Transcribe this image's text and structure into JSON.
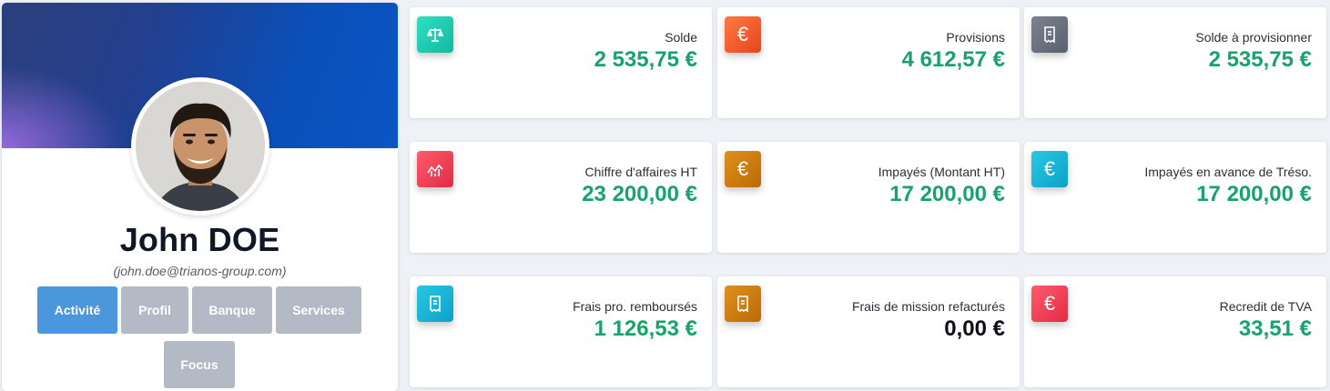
{
  "profile": {
    "name": "John DOE",
    "email": "(john.doe@trianos-group.com)",
    "tabs": [
      "Activité",
      "Profil",
      "Banque",
      "Services",
      "Focus"
    ]
  },
  "cards": [
    {
      "label": "Solde",
      "value": "2 535,75 €",
      "icon": "balance-scale-icon",
      "color": "#13b8a4"
    },
    {
      "label": "Provisions",
      "value": "4 612,57 €",
      "icon": "euro-icon",
      "color": "#e8441c"
    },
    {
      "label": "Solde à provisionner",
      "value": "2 535,75 €",
      "icon": "receipt-icon",
      "color": "#596170"
    },
    {
      "label": "Chiffre d'affaires HT",
      "value": "23 200,00 €",
      "icon": "chart-line-icon",
      "color": "#e22b45"
    },
    {
      "label": "Impayés (Montant HT)",
      "value": "17 200,00 €",
      "icon": "euro-icon",
      "color": "#bb6a05"
    },
    {
      "label": "Impayés en avance de Tréso.",
      "value": "17 200,00 €",
      "icon": "euro-icon",
      "color": "#0ea0c8"
    },
    {
      "label": "Frais pro. remboursés",
      "value": "1 126,53 €",
      "icon": "receipt-icon",
      "color": "#0ea0c8"
    },
    {
      "label": "Frais de mission refacturés",
      "value": "0,00 €",
      "icon": "receipt-icon",
      "color": "#bb6a05"
    },
    {
      "label": "Recredit de TVA",
      "value": "33,51 €",
      "icon": "euro-icon",
      "color": "#e22b45"
    }
  ],
  "colors": {
    "accent": "#4a97de",
    "value_green": "#17a36b",
    "tab_inactive": "#b3bac6"
  }
}
